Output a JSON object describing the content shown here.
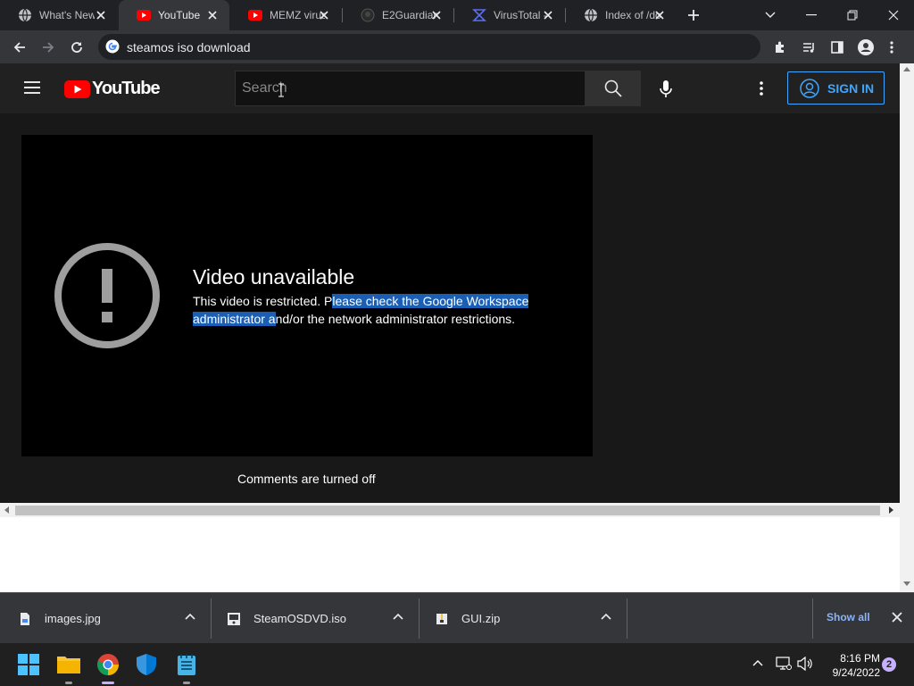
{
  "browser": {
    "tabs": [
      {
        "title": "What's New",
        "icon": "globe-icon"
      },
      {
        "title": "YouTube",
        "icon": "youtube-icon"
      },
      {
        "title": "MEMZ virus",
        "icon": "youtube-icon"
      },
      {
        "title": "E2Guardian",
        "icon": "github-icon"
      },
      {
        "title": "VirusTotal -",
        "icon": "virustotal-icon"
      },
      {
        "title": "Index of /do",
        "icon": "globe-icon"
      }
    ],
    "active_tab": 1,
    "address": "steamos iso download"
  },
  "youtube": {
    "logo_text": "YouTube",
    "search_placeholder": "Search",
    "sign_in": "SIGN IN",
    "error_title": "Video unavailable",
    "error_msg_part1": "This video is restricted. P",
    "error_msg_highlight": "lease check the Google Workspace administrator a",
    "error_msg_part2": "nd/or the network administrator restrictions.",
    "comments": "Comments are turned off"
  },
  "downloads": {
    "items": [
      {
        "name": "images.jpg"
      },
      {
        "name": "SteamOSDVD.iso"
      },
      {
        "name": "GUI.zip"
      }
    ],
    "show_all": "Show all"
  },
  "taskbar": {
    "time": "8:16 PM",
    "date": "9/24/2022",
    "notifications": "2"
  },
  "colors": {
    "accent_blue": "#3ea6ff",
    "youtube_red": "#ff0000",
    "selection": "#1a5fb4"
  }
}
